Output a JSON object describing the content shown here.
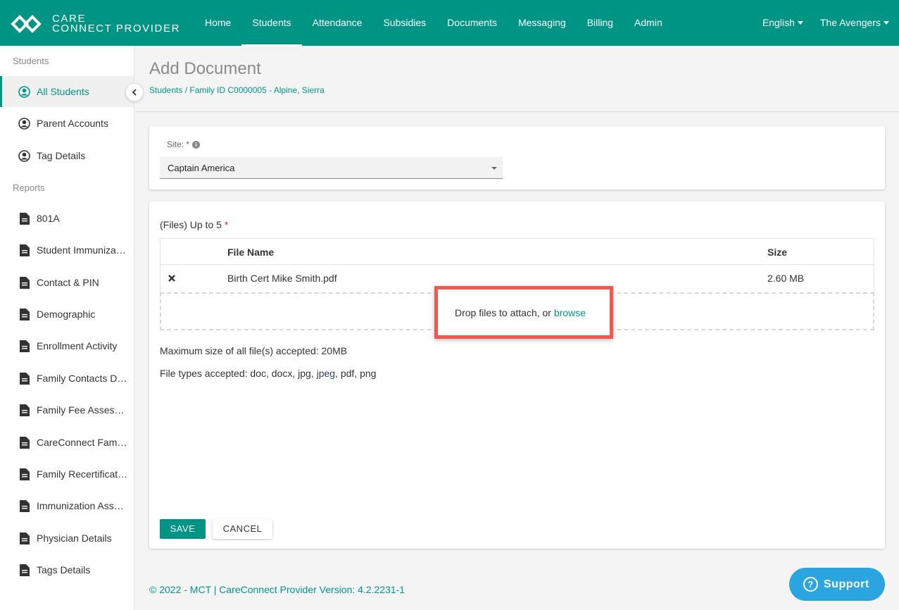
{
  "app": {
    "logo_line1": "CARE",
    "logo_line2": "CONNECT PROVIDER",
    "brand_color": "#009485"
  },
  "nav": {
    "items": [
      {
        "label": "Home",
        "active": false
      },
      {
        "label": "Students",
        "active": true
      },
      {
        "label": "Attendance",
        "active": false
      },
      {
        "label": "Subsidies",
        "active": false
      },
      {
        "label": "Documents",
        "active": false
      },
      {
        "label": "Messaging",
        "active": false
      },
      {
        "label": "Billing",
        "active": false
      },
      {
        "label": "Admin",
        "active": false
      }
    ],
    "language": "English",
    "account": "The Avengers"
  },
  "sidebar": {
    "students_heading": "Students",
    "students_items": [
      {
        "label": "All Students",
        "icon": "user-circle-icon",
        "active": true
      },
      {
        "label": "Parent Accounts",
        "icon": "user-circle-icon"
      },
      {
        "label": "Tag Details",
        "icon": "user-circle-icon"
      }
    ],
    "reports_heading": "Reports",
    "reports_items": [
      {
        "label": "801A",
        "icon": "document-icon"
      },
      {
        "label": "Student Immunizations",
        "icon": "document-icon"
      },
      {
        "label": "Contact & PIN",
        "icon": "document-icon"
      },
      {
        "label": "Demographic",
        "icon": "document-icon"
      },
      {
        "label": "Enrollment Activity",
        "icon": "document-icon"
      },
      {
        "label": "Family Contacts Details",
        "icon": "document-icon"
      },
      {
        "label": "Family Fee Assessments",
        "icon": "document-icon"
      },
      {
        "label": "CareConnect Family Accounts",
        "icon": "document-icon"
      },
      {
        "label": "Family Recertifications",
        "icon": "document-icon"
      },
      {
        "label": "Immunization Assessments",
        "icon": "document-icon"
      },
      {
        "label": "Physician Details",
        "icon": "document-icon"
      },
      {
        "label": "Tags Details",
        "icon": "document-icon"
      }
    ]
  },
  "page": {
    "title": "Add Document",
    "breadcrumb": "Students / Family ID C0000005 - Alpine, Sierra"
  },
  "site_card": {
    "label": "Site: *",
    "selected": "Captain America"
  },
  "files_card": {
    "label": "(Files) Up to 5",
    "required_mark": "*",
    "columns": {
      "name": "File Name",
      "size": "Size"
    },
    "files": [
      {
        "name": "Birth Cert Mike Smith.pdf",
        "size": "2.60 MB"
      }
    ],
    "drop_text": "Drop files to attach, or",
    "browse_text": "browse",
    "max_size_text": "Maximum size of all file(s) accepted: 20MB",
    "types_prefix": "File types accepted: doc, docx, jpg,",
    "types_jpeg": "jpeg",
    "types_suffix": ", pdf, png",
    "save_label": "SAVE",
    "cancel_label": "CANCEL"
  },
  "footer": {
    "text": "© 2022 - MCT | CareConnect Provider Version: 4.2.2231-1"
  },
  "support": {
    "label": "Support",
    "color": "#2aa5e0"
  },
  "highlight_color": "#f05a4e"
}
